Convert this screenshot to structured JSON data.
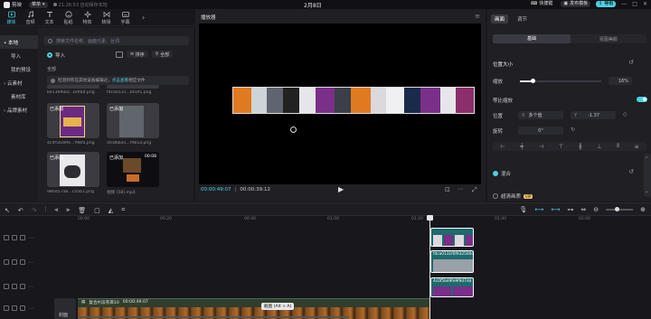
{
  "app": {
    "name": "剪映",
    "menu_label": "菜单",
    "autosave": "21:26:53 自动保存本地",
    "project_title": "2月8日",
    "shortcut_label": "快捷键",
    "publish_label": "发布模板",
    "export_label": "导出"
  },
  "media_tabs": [
    {
      "label": "媒体",
      "icon": "media-icon"
    },
    {
      "label": "音频",
      "icon": "audio-icon"
    },
    {
      "label": "文本",
      "icon": "text-icon"
    },
    {
      "label": "贴纸",
      "icon": "sticker-icon"
    },
    {
      "label": "特效",
      "icon": "effect-icon"
    },
    {
      "label": "转场",
      "icon": "transition-icon"
    },
    {
      "label": "字幕",
      "icon": "caption-icon"
    }
  ],
  "left_nav": [
    {
      "label": "• 本地",
      "active": true
    },
    {
      "label": "导入"
    },
    {
      "label": "我的预设"
    },
    {
      "label": "› 云素材"
    },
    {
      "label": "素材库"
    },
    {
      "label": "› 品牌素材"
    }
  ],
  "search": {
    "placeholder": "搜索文件名称、画面元素、台词"
  },
  "import_label": "导入",
  "sort_label": "排序",
  "filter_label": "全部",
  "all_label": "全部",
  "notice": {
    "text": "检测到有在其他设备编辑过，",
    "link": "点击查看",
    "tail": "相应文件"
  },
  "media_files": [
    {
      "name": "be136f6ba...bdfbd.png",
      "kind": "top"
    },
    {
      "name": "fdca0131...b03f1.png",
      "kind": "top"
    },
    {
      "name": "4c0f5bd9fe...f98fa.png",
      "kind": "book",
      "badge": "已添加"
    },
    {
      "name": "afc86ba5...f9b1a.png",
      "kind": "gray",
      "badge": "已添加"
    },
    {
      "name": "986d57ab...ca5b1.png",
      "kind": "ink",
      "badge": "已添加"
    },
    {
      "name": "视频 (58).mp4",
      "kind": "video",
      "badge": "已添加",
      "duration": "00:08"
    }
  ],
  "player": {
    "title": "播放器",
    "current_time": "00:00:49:07",
    "total_time": "00:00:39:12"
  },
  "inspector": {
    "tabs": [
      "画面",
      "调节"
    ],
    "subtabs": [
      "基础",
      "抠图美颜"
    ],
    "section_title": "位置大小",
    "scale_label": "缩放",
    "scale_value": "16%",
    "uniform_scale_label": "等比缩放",
    "position_label": "位置",
    "pos_x_label": "X",
    "pos_x": "多个值",
    "pos_y_label": "Y",
    "pos_y": "-1.37",
    "rotation_label": "旋转",
    "rotation": "0°",
    "blend_label": "混合",
    "smart_label": "超清画质",
    "vip_badge": "VIP"
  },
  "timeline": {
    "ruler": [
      "00:00",
      "00:20",
      "00:40",
      "01:00",
      "01:20",
      "01:40",
      "02:00"
    ],
    "main_clip": {
      "name": "复合片段有目10",
      "duration": "00:00:49:07"
    },
    "cover_label": "封面",
    "tooltip": "截图 (Alt + A)",
    "clip2": "fdca0131f0f932500c4",
    "clip3": "4c0f5bd9fe9f9d7dd"
  },
  "colors": {
    "accent": "#4bd0e0",
    "panel": "#1f1f24",
    "clip_teal": "#1e6a6e",
    "main_clip": "#2f3e2e"
  }
}
